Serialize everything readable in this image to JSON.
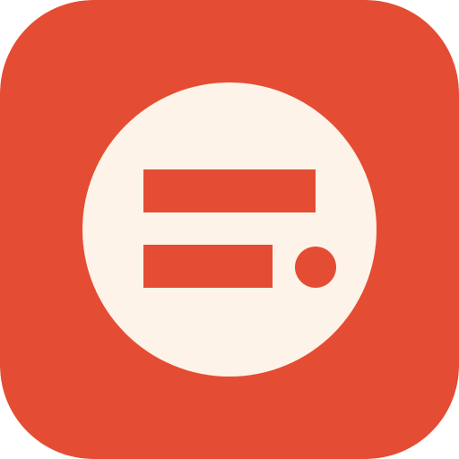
{
  "icon": {
    "name": "app-icon",
    "glyph": "menu-lines-with-dot-icon"
  },
  "colors": {
    "background": "#E44D33",
    "disc": "#FDF3E8",
    "foreground": "#E44D33"
  }
}
